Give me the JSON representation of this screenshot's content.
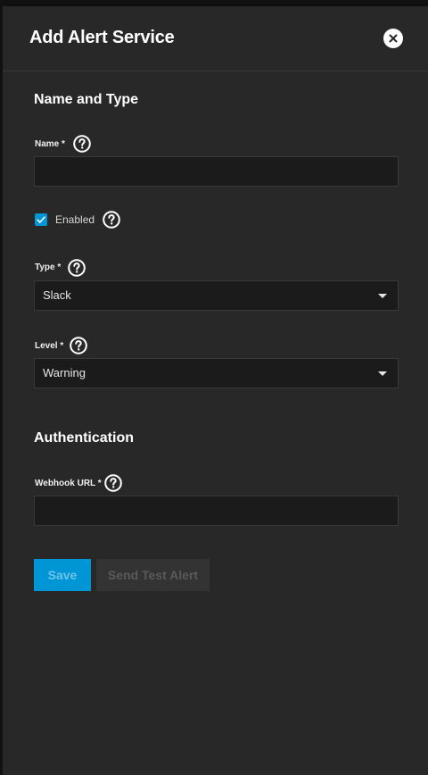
{
  "dialog": {
    "title": "Add Alert Service",
    "close_icon": "close-icon"
  },
  "sections": {
    "name_type": "Name and Type",
    "authentication": "Authentication"
  },
  "fields": {
    "name": {
      "label": "Name *",
      "value": "",
      "placeholder": ""
    },
    "enabled": {
      "label": "Enabled",
      "checked": true
    },
    "type": {
      "label": "Type *",
      "value": "Slack"
    },
    "level": {
      "label": "Level *",
      "value": "Warning"
    },
    "webhook_url": {
      "label": "Webhook URL *",
      "value": "",
      "placeholder": ""
    }
  },
  "buttons": {
    "save": "Save",
    "send_test_alert": "Send Test Alert"
  },
  "colors": {
    "background": "#282828",
    "input_background": "#1b1b1b",
    "accent": "#0095d5",
    "text": "#ffffff"
  }
}
